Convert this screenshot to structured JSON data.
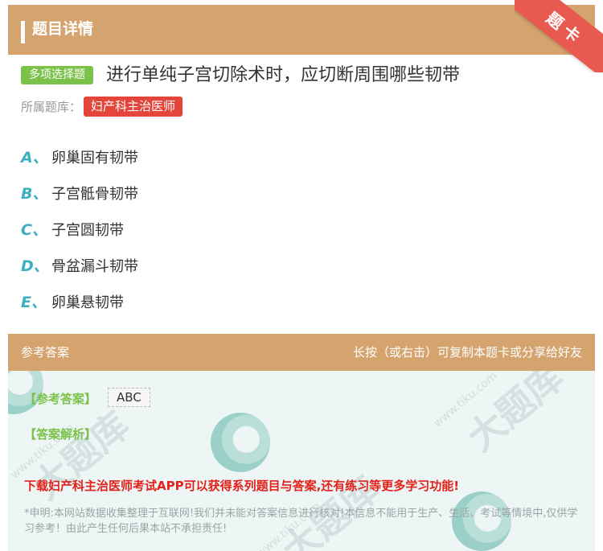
{
  "header": {
    "title": "题目详情",
    "corner": "题卡"
  },
  "question": {
    "type_badge": "多项选择题",
    "text": "进行单纯子宫切除术时，应切断周围哪些韧带",
    "bank_label": "所属题库：",
    "bank_name": "妇产科主治医师"
  },
  "options": [
    {
      "letter": "A、",
      "text": "卵巢固有韧带"
    },
    {
      "letter": "B、",
      "text": "子宫骶骨韧带"
    },
    {
      "letter": "C、",
      "text": "子宫圆韧带"
    },
    {
      "letter": "D、",
      "text": "骨盆漏斗韧带"
    },
    {
      "letter": "E、",
      "text": "卵巢悬韧带"
    }
  ],
  "answer_section": {
    "title": "参考答案",
    "hint": "长按（或右击）可复制本题卡或分享给好友",
    "answer_label": "【参考答案】",
    "answer_value": "ABC",
    "analysis_label": "【答案解析】",
    "promo": "下载妇产科主治医师考试APP可以获得系列题目与答案,还有练习等更多学习功能!",
    "disclaimer": "*申明:本网站数据收集整理于互联网!我们并未能对答案信息进行核对!本信息不能用于生产、生活、考试等情境中,仅供学习参考！由此产生任何后果本站不承担责任!"
  },
  "colors": {
    "header_bg": "#d4a36e",
    "badge_green": "#7cc24a",
    "tag_red": "#e4453a",
    "option_letter": "#3cb0c0",
    "promo_red": "#e4201a"
  }
}
